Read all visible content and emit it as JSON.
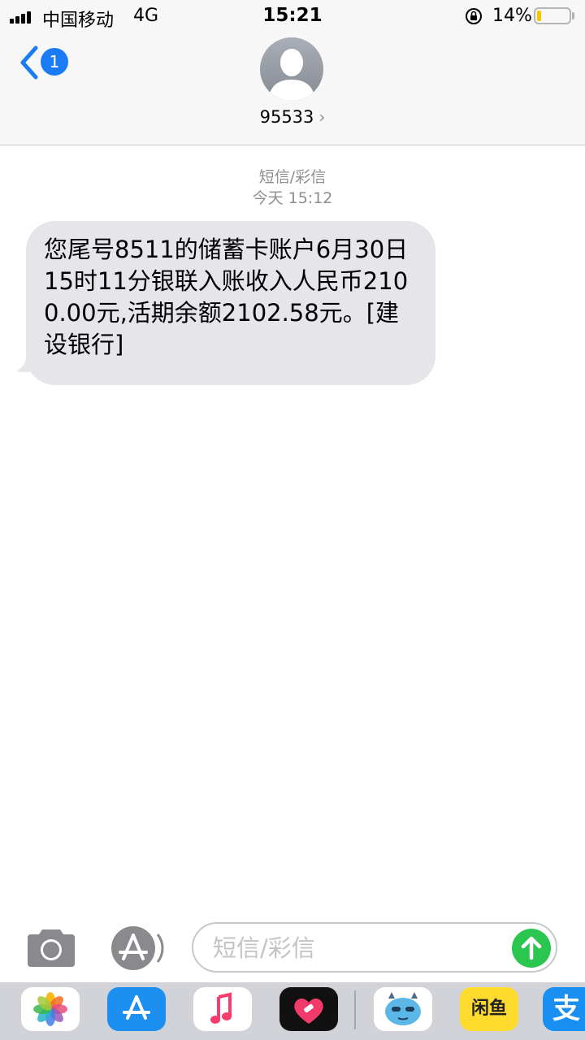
{
  "status_bar": {
    "carrier": "中国移动",
    "network": "4G",
    "time": "15:21",
    "battery_percent": "14%",
    "battery_level": 0.14
  },
  "header": {
    "back_badge_count": "1",
    "contact_name": "95533",
    "contact_chevron": "›"
  },
  "thread": {
    "message_type": "短信/彩信",
    "timestamp": "今天 15:12",
    "messages": [
      {
        "direction": "incoming",
        "text": "您尾号8511的储蓄卡账户6月30日15时11分银联入账收入人民币2100.00元,活期余额2102.58元。[建设银行]"
      }
    ]
  },
  "composer": {
    "placeholder": "短信/彩信",
    "value": ""
  },
  "app_drawer": {
    "apps": [
      {
        "name": "Photos",
        "icon": "photos-icon"
      },
      {
        "name": "App Store",
        "icon": "app-store-icon"
      },
      {
        "name": "Music",
        "icon": "music-icon"
      },
      {
        "name": "Heart sticker app",
        "icon": "heart-app-icon"
      },
      {
        "name": "Monster sticker app",
        "icon": "monster-app-icon"
      },
      {
        "name": "Xianyu",
        "icon": "xianyu-icon",
        "label": "闲鱼"
      },
      {
        "name": "Alipay",
        "icon": "alipay-icon",
        "label": "支"
      }
    ]
  },
  "colors": {
    "accent_blue": "#1a7cf5",
    "bubble_gray": "#e5e5ea",
    "send_green": "#2bc64f",
    "meta_gray": "#8e8e93",
    "battery_yellow": "#f6c700"
  }
}
